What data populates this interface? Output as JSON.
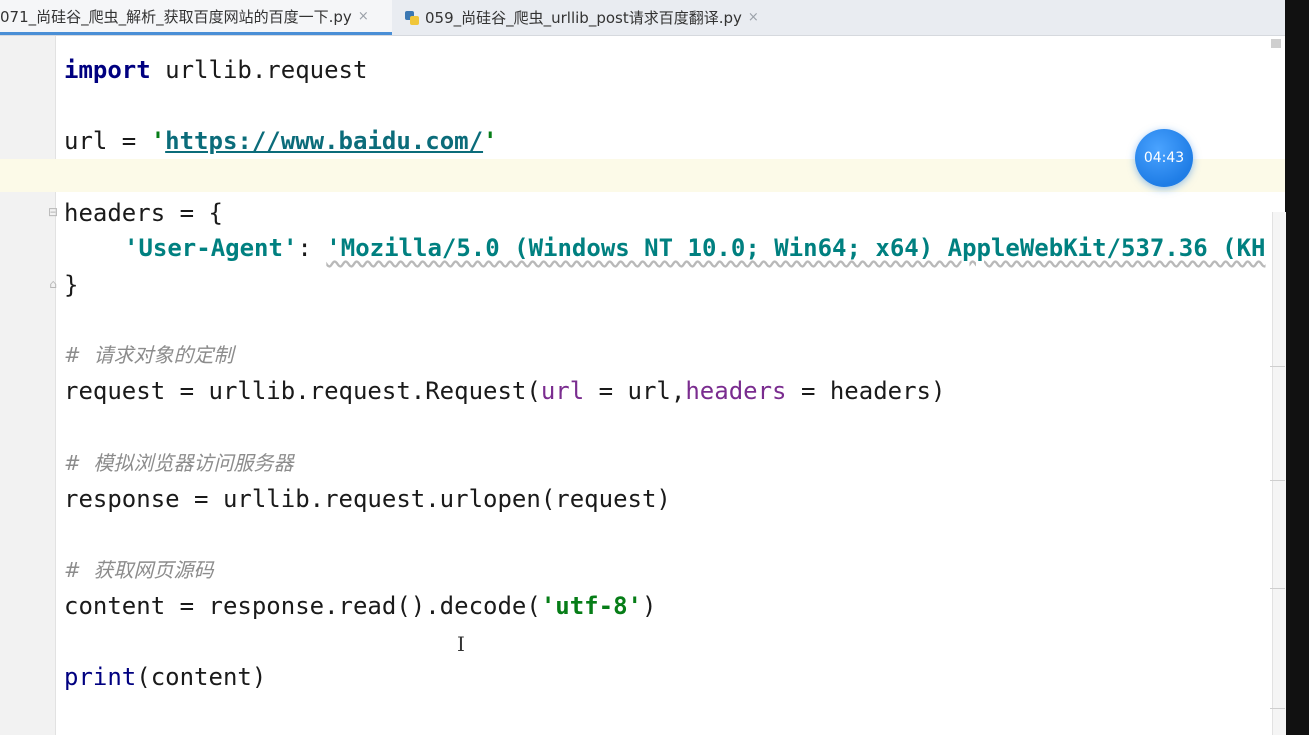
{
  "tabs": [
    {
      "label": "071_尚硅谷_爬虫_解析_获取百度网站的百度一下.py",
      "active": true
    },
    {
      "label": "059_尚硅谷_爬虫_urllib_post请求百度翻译.py",
      "active": false
    }
  ],
  "close_glyph": "×",
  "timer": "04:43",
  "code": {
    "import_kw": "import",
    "import_mod": " urllib.request",
    "url_lhs": "url = ",
    "url_quote_open": "'",
    "url_value": "https://www.baidu.com/",
    "url_quote_close": "'",
    "headers_open": "headers = {",
    "ua_key": "'User-Agent'",
    "ua_colon": ": ",
    "ua_value": "'Mozilla/5.0 (Windows NT 10.0; Win64; x64) AppleWebKit/537.36 (KH",
    "headers_close": "}",
    "comment1": "#  请求对象的定制",
    "request_prefix": "request = urllib.request.Request(",
    "request_param1": "url",
    "request_eq1": " = url,",
    "request_param2": "headers",
    "request_eq2": " = headers)",
    "comment2": "#  模拟浏览器访问服务器",
    "response_line": "response = urllib.request.urlopen(request)",
    "comment3": "#  获取网页源码",
    "content_prefix": "content = response.read().decode(",
    "content_str": "'utf-8'",
    "content_suffix": ")",
    "print_kw": "print",
    "print_args": "(content)"
  },
  "colors": {
    "keyword": "#000080",
    "string": "#067d17",
    "dict_key": "#008080",
    "param": "#7a2c8f",
    "comment": "#8c8c8c",
    "timer_bg": "#1f7de6"
  }
}
